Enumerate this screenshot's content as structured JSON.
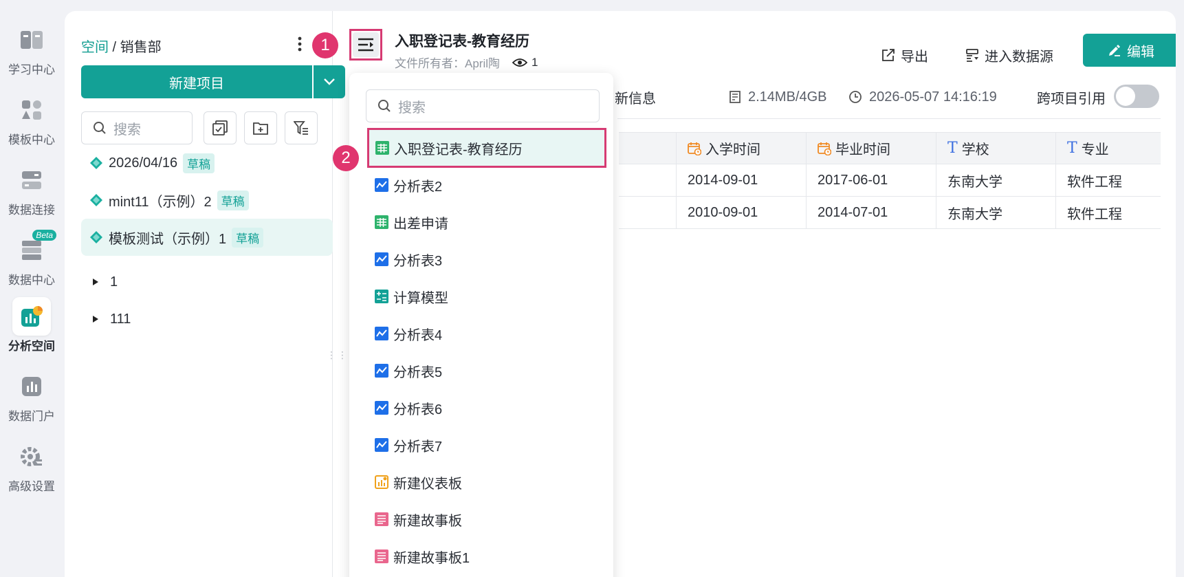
{
  "rail": {
    "items": [
      {
        "label": "学习中心",
        "icon": "learning-center-icon"
      },
      {
        "label": "模板中心",
        "icon": "template-center-icon"
      },
      {
        "label": "数据连接",
        "icon": "data-connection-icon"
      },
      {
        "label": "数据中心",
        "icon": "data-center-icon",
        "badge": "Beta"
      },
      {
        "label": "分析空间",
        "icon": "analysis-space-icon",
        "active": true
      },
      {
        "label": "数据门户",
        "icon": "data-portal-icon"
      },
      {
        "label": "高级设置",
        "icon": "advanced-settings-icon"
      }
    ]
  },
  "sidebar": {
    "breadcrumb_link": "空间",
    "breadcrumb_sep": " / ",
    "breadcrumb_current": "销售部",
    "new_project_label": "新建项目",
    "search_placeholder": "搜索",
    "projects": [
      {
        "name": "2026/04/16",
        "badge": "草稿"
      },
      {
        "name": "mint11（示例）2",
        "badge": "草稿"
      },
      {
        "name": "模板测试（示例）1",
        "badge": "草稿",
        "selected": true
      }
    ],
    "folders": [
      {
        "name": "1"
      },
      {
        "name": "111"
      }
    ]
  },
  "steps": {
    "one": "1",
    "two": "2"
  },
  "header": {
    "title": "入职登记表-教育经历",
    "owner": "文件所有者：April陶",
    "views": "1",
    "export_label": "导出",
    "datasource_label": "进入数据源",
    "edit_label": "编辑"
  },
  "info": {
    "partial_text": "新信息",
    "storage": "2.14MB/4GB",
    "updated": "2026-05-07 14:16:19",
    "cross_ref_label": "跨项目引用"
  },
  "table": {
    "columns": [
      {
        "label": "",
        "type": "none"
      },
      {
        "label": "入学时间",
        "type": "date"
      },
      {
        "label": "毕业时间",
        "type": "date"
      },
      {
        "label": "学校",
        "type": "text"
      },
      {
        "label": "专业",
        "type": "text"
      }
    ],
    "rows": [
      [
        "",
        "2014-09-01",
        "2017-06-01",
        "东南大学",
        "软件工程"
      ],
      [
        "",
        "2010-09-01",
        "2014-07-01",
        "东南大学",
        "软件工程"
      ]
    ]
  },
  "dropdown": {
    "search_placeholder": "搜索",
    "items": [
      {
        "label": "入职登记表-教育经历",
        "icon": "table-icon",
        "highlighted": true
      },
      {
        "label": "分析表2",
        "icon": "analysis-table-icon"
      },
      {
        "label": "出差申请",
        "icon": "table-icon"
      },
      {
        "label": "分析表3",
        "icon": "analysis-table-icon"
      },
      {
        "label": "计算模型",
        "icon": "calc-model-icon"
      },
      {
        "label": "分析表4",
        "icon": "analysis-table-icon"
      },
      {
        "label": "分析表5",
        "icon": "analysis-table-icon"
      },
      {
        "label": "分析表6",
        "icon": "analysis-table-icon"
      },
      {
        "label": "分析表7",
        "icon": "analysis-table-icon"
      },
      {
        "label": "新建仪表板",
        "icon": "dashboard-icon"
      },
      {
        "label": "新建故事板",
        "icon": "storyboard-icon"
      },
      {
        "label": "新建故事板1",
        "icon": "storyboard-icon"
      }
    ]
  },
  "colors": {
    "brand": "#13a196",
    "highlight_border": "#d63b73",
    "step_badge": "#e0356e",
    "date_icon": "#f08a24",
    "text_icon": "#3d6fe0",
    "analysis_icon": "#1e6fe8",
    "table_icon": "#2eb36c",
    "dashboard_icon": "#f0a21c",
    "storyboard_icon": "#e9668d"
  }
}
